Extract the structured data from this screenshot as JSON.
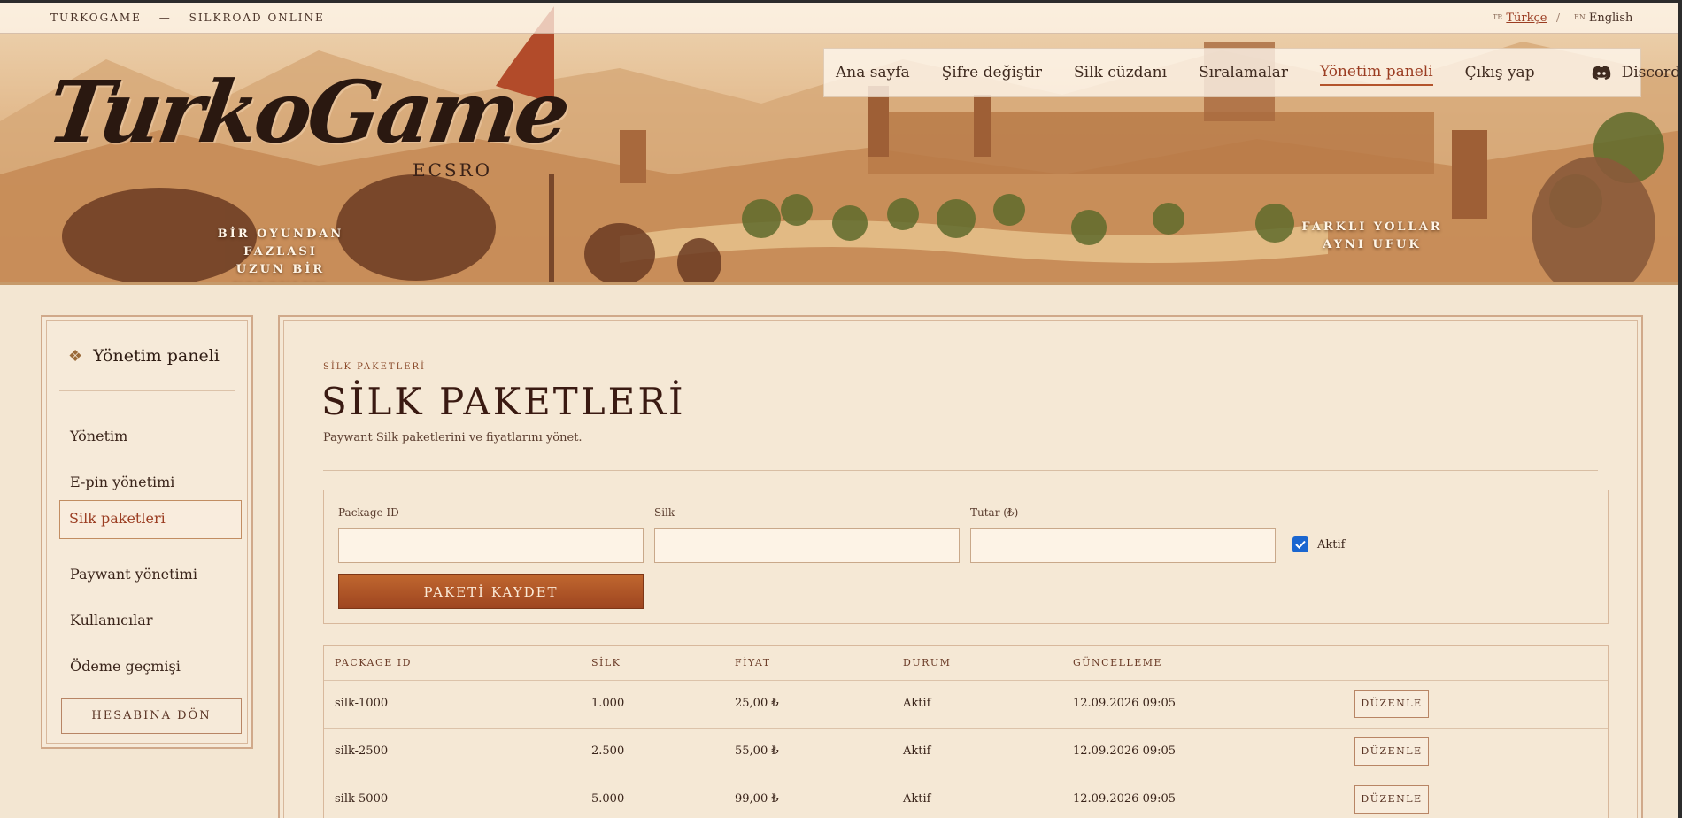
{
  "topbar": {
    "brand": "TURKOGAME",
    "dash": "—",
    "product": "SILKROAD ONLINE",
    "lang_tr_code": "TR",
    "lang_tr": "Türkçe",
    "lang_sep": "/",
    "lang_en_code": "EN",
    "lang_en": "English"
  },
  "nav": {
    "items": [
      "Ana sayfa",
      "Şifre değiştir",
      "Silk cüzdanı",
      "Sıralamalar",
      "Yönetim paneli",
      "Çıkış yap"
    ],
    "active_index": 4,
    "discord": "Discord"
  },
  "hero": {
    "logo": "TurkoGame",
    "logo_sub": "ECSRO",
    "tagline_left_1": "BİR OYUNDAN FAZLASI",
    "tagline_left_2": "UZUN BİR YOLCULUK",
    "tagline_right_1": "FARKLI YOLLAR",
    "tagline_right_2": "AYNI UFUK"
  },
  "sidebar": {
    "title": "Yönetim paneli",
    "items": [
      "Yönetim",
      "E-pin yönetimi",
      "Silk paketleri",
      "Paywant yönetimi",
      "Kullanıcılar",
      "Ödeme geçmişi"
    ],
    "active_index": 2,
    "back_label": "HESABINA DÖN"
  },
  "page": {
    "eyebrow": "SİLK PAKETLERİ",
    "title": "SİLK PAKETLERİ",
    "subtitle": "Paywant Silk paketlerini ve fiyatlarını yönet."
  },
  "form": {
    "package_id_label": "Package ID",
    "package_id_value": "",
    "silk_label": "Silk",
    "silk_value": "",
    "amount_label": "Tutar (₺)",
    "amount_value": "",
    "active_label": "Aktif",
    "active_checked": true,
    "save_label": "PAKETİ KAYDET"
  },
  "table": {
    "columns": [
      "PACKAGE ID",
      "SİLK",
      "FİYAT",
      "DURUM",
      "GÜNCELLEME"
    ],
    "rows": [
      {
        "package_id": "silk-1000",
        "silk": "1.000",
        "price": "25,00 ₺",
        "status": "Aktif",
        "updated": "12.09.2026 09:05"
      },
      {
        "package_id": "silk-2500",
        "silk": "2.500",
        "price": "55,00 ₺",
        "status": "Aktif",
        "updated": "12.09.2026 09:05"
      },
      {
        "package_id": "silk-5000",
        "silk": "5.000",
        "price": "99,00 ₺",
        "status": "Aktif",
        "updated": "12.09.2026 09:05"
      }
    ],
    "edit_label": "DÜZENLE"
  },
  "colors": {
    "accent": "#9b3d22",
    "button": "#b0552a",
    "background": "#f3e6d2"
  }
}
